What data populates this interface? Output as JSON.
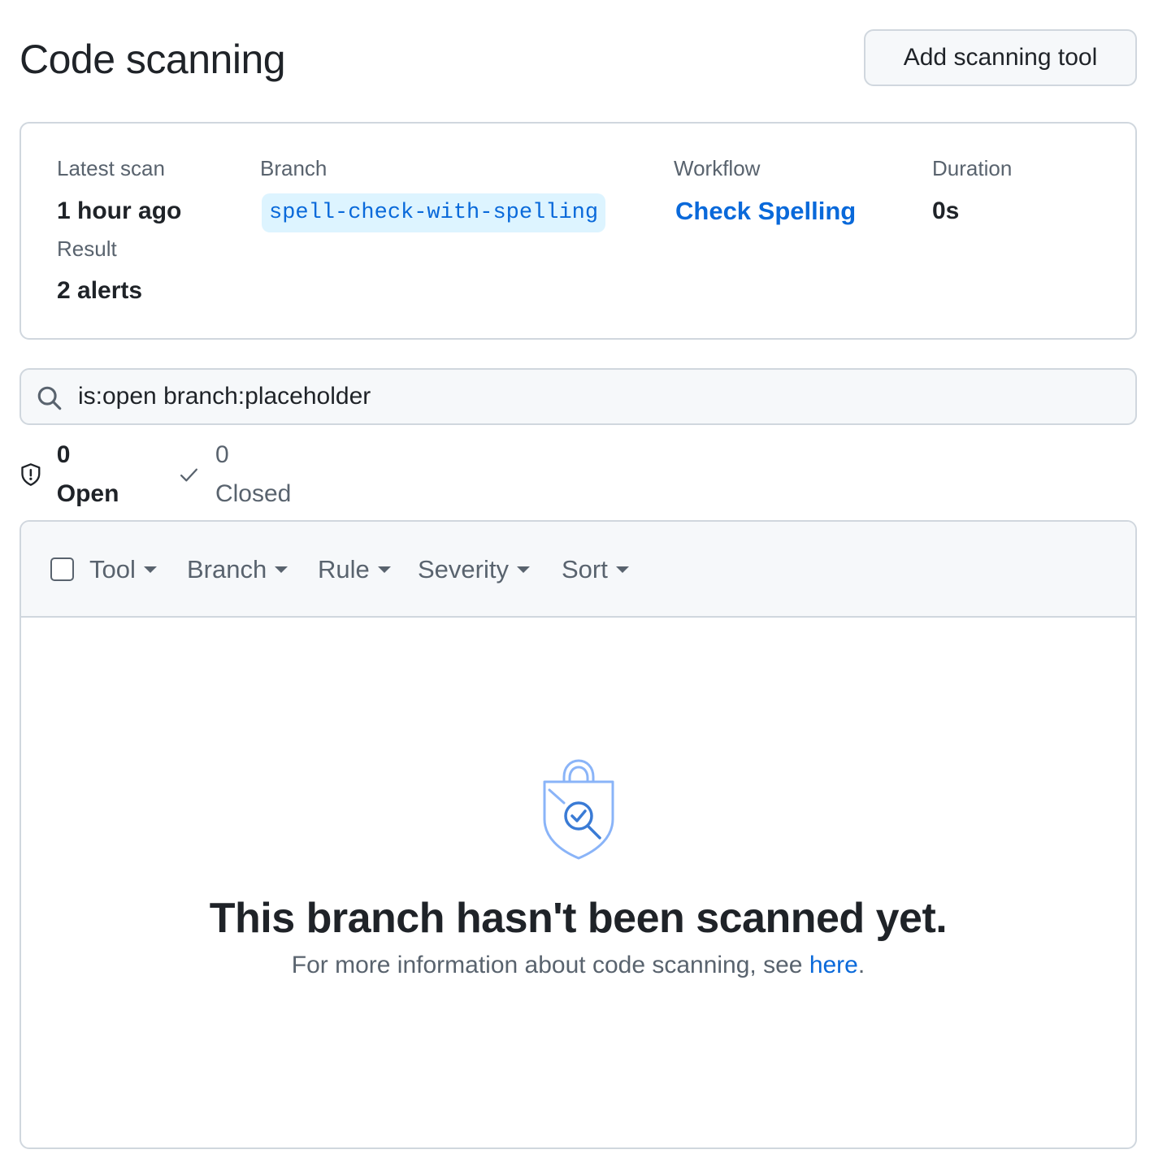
{
  "header": {
    "title": "Code scanning",
    "add_tool_label": "Add scanning tool"
  },
  "scan_summary": {
    "latest_scan_label": "Latest scan",
    "latest_scan_value": "1 hour ago",
    "result_label": "Result",
    "result_value": "2 alerts",
    "branch_label": "Branch",
    "branch_value": "spell-check-with-spelling",
    "workflow_label": "Workflow",
    "workflow_value": "Check Spelling",
    "duration_label": "Duration",
    "duration_value": "0s"
  },
  "search": {
    "value": "is:open branch:placeholder",
    "icon": "search-icon"
  },
  "state_tabs": {
    "open_label": "0 Open",
    "open_icon": "shield-alert-icon",
    "closed_label": "0 Closed",
    "closed_icon": "check-icon"
  },
  "filters": [
    {
      "label": "Tool"
    },
    {
      "label": "Branch"
    },
    {
      "label": "Rule"
    },
    {
      "label": "Severity"
    },
    {
      "label": "Sort"
    }
  ],
  "empty_state": {
    "icon": "shield-lock-check-icon",
    "title": "This branch hasn't been scanned yet.",
    "description_prefix": "For more information about code scanning, see ",
    "link_text": "here",
    "description_suffix": "."
  },
  "colors": {
    "accent": "#0969da",
    "text_primary": "#1f2328",
    "text_muted": "#59636e",
    "border": "#d0d7de",
    "chip_bg": "#ddf4ff",
    "illustration_light": "#8ab4f8",
    "illustration_dark": "#3a7bd5"
  }
}
